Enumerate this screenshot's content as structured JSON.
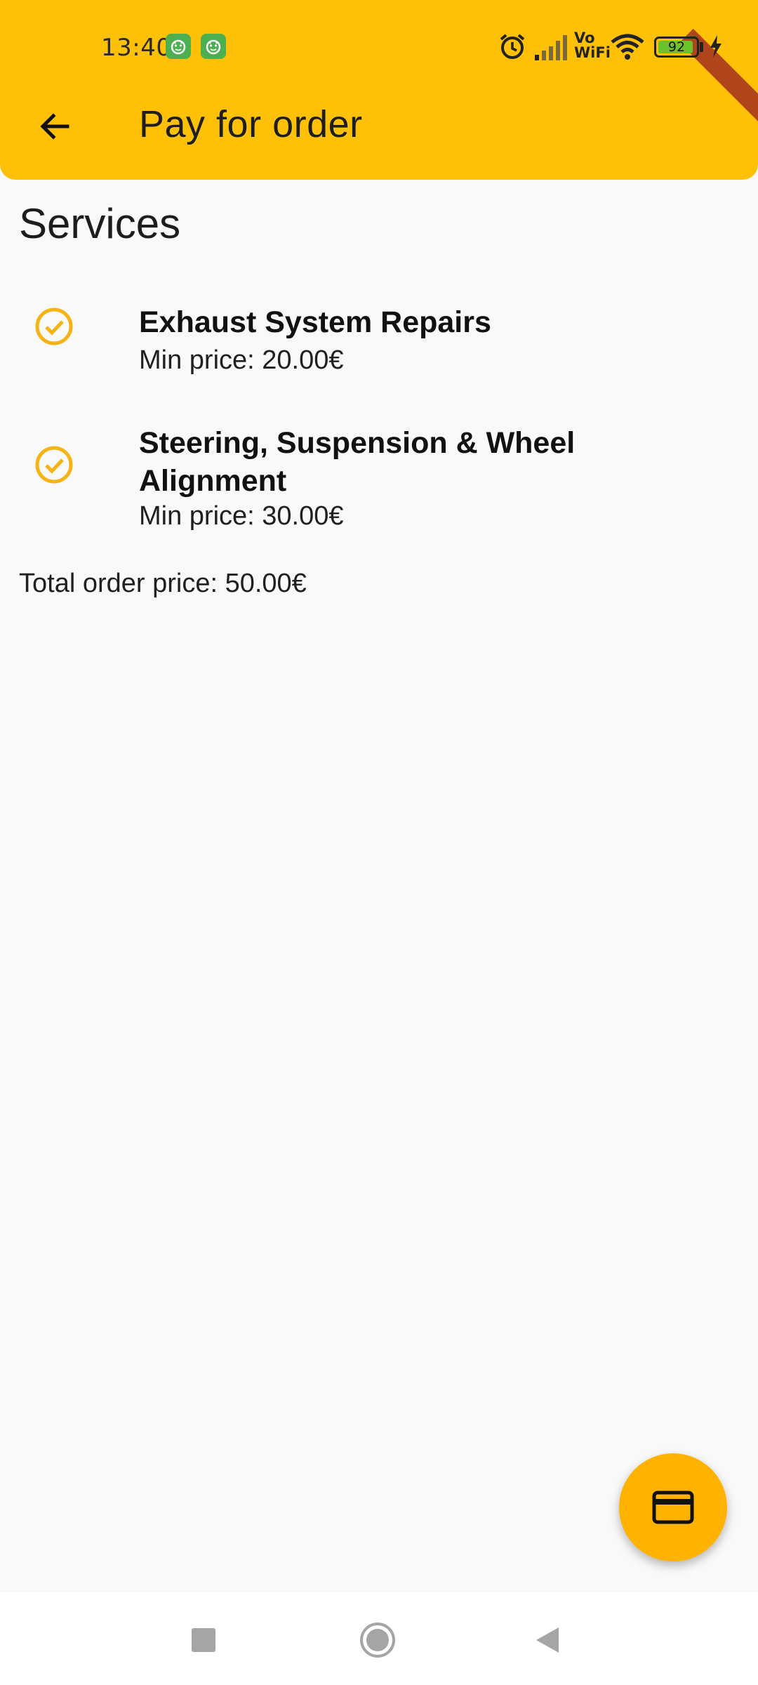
{
  "status_bar": {
    "time": "13:40",
    "battery_level": "92",
    "wifi_label_top": "Vo",
    "wifi_label_bottom": "WiFi",
    "icons": [
      "app-notification-icon",
      "app-notification-icon",
      "alarm-icon",
      "signal-icon",
      "vowifi-icon",
      "wifi-icon",
      "battery-icon",
      "charging-icon"
    ]
  },
  "app_bar": {
    "title": "Pay for order",
    "back_icon": "arrow-back-icon",
    "color": "#ffc107"
  },
  "section": {
    "title": "Services"
  },
  "services": [
    {
      "name": "Exhaust System Repairs",
      "price": "Min price: 20.00€",
      "icon": "check-circle-icon"
    },
    {
      "name": "Steering, Suspension & Wheel Alignment",
      "price": "Min price: 30.00€",
      "icon": "check-circle-icon"
    }
  ],
  "total": {
    "text": "Total order price: 50.00€"
  },
  "fab": {
    "icon": "credit-card-icon",
    "color": "#ffb300"
  },
  "nav_bar": {
    "icons": [
      "recents-square-icon",
      "home-circle-icon",
      "back-triangle-icon"
    ]
  },
  "colors": {
    "accent": "#ffc107",
    "check": "#f5b316",
    "background": "#f9f9f9"
  }
}
